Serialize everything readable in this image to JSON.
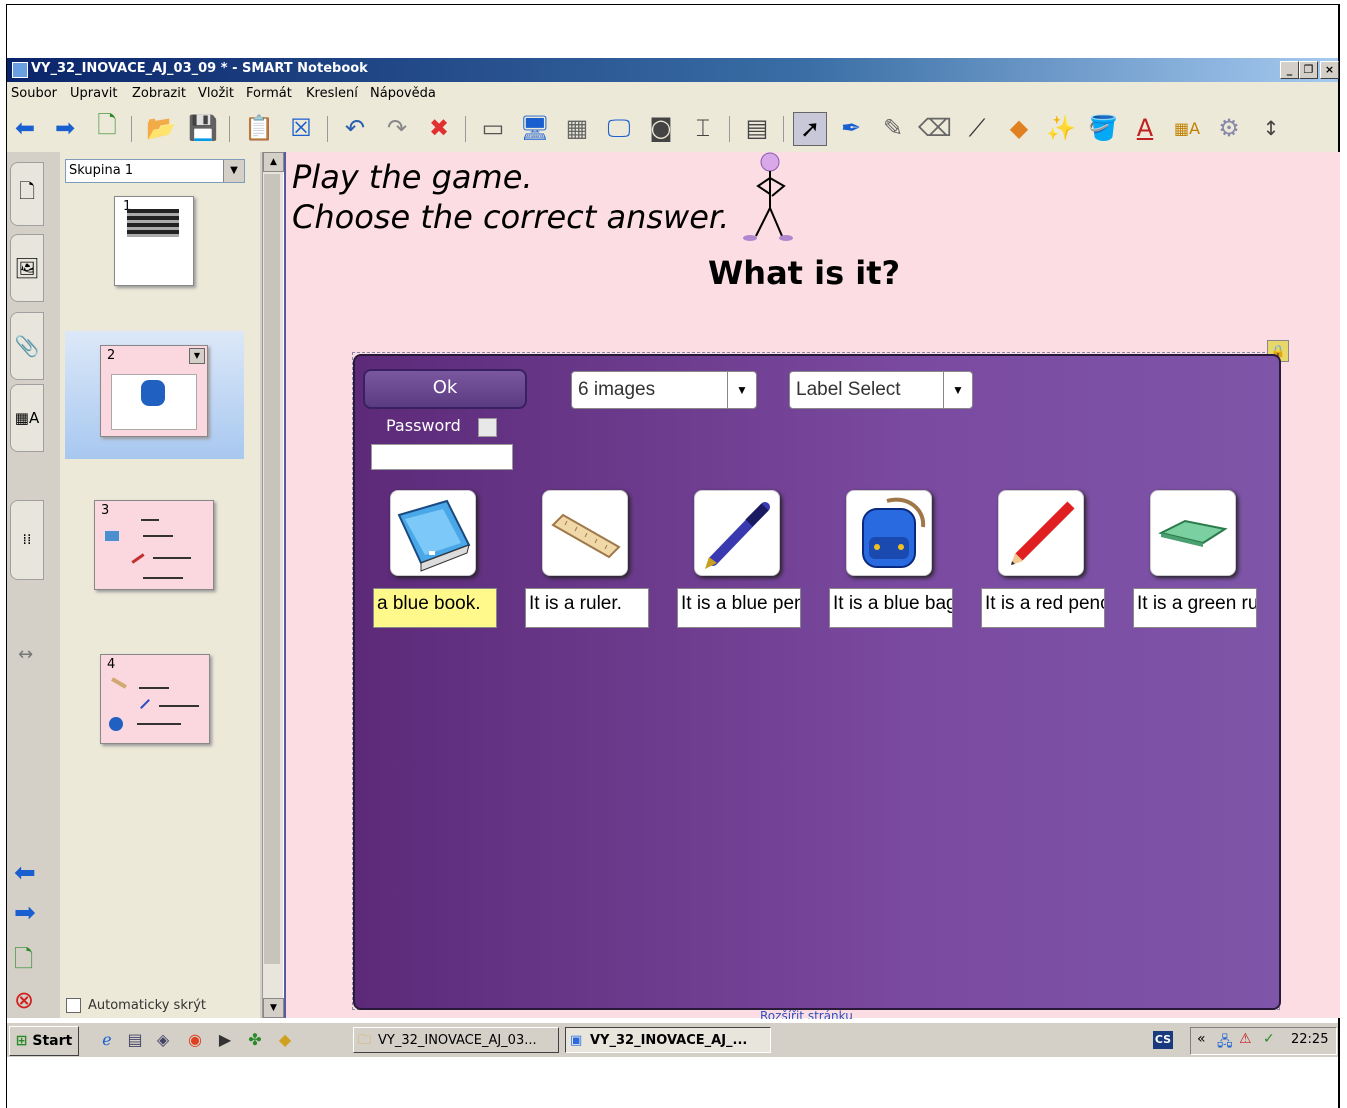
{
  "window": {
    "title": "VY_32_INOVACE_AJ_03_09 * - SMART Notebook",
    "buttons": {
      "minimize": "_",
      "restore": "❐",
      "close": "×"
    }
  },
  "menu": [
    "Soubor",
    "Upravit",
    "Zobrazit",
    "Vložit",
    "Formát",
    "Kreslení",
    "Nápověda"
  ],
  "toolbar": {
    "icons": [
      "back-arrow-icon",
      "forward-arrow-icon",
      "add-page-icon",
      "open-folder-icon",
      "save-icon",
      "paste-icon",
      "delete-page-icon",
      "undo-icon",
      "redo-icon",
      "delete-icon",
      "screen-shade-icon",
      "full-screen-icon",
      "transparent-icon",
      "dual-display-icon",
      "screen-capture-icon",
      "document-camera-icon",
      "table-icon",
      "select-arrow-icon",
      "pen-icon",
      "creative-pen-icon",
      "eraser-icon",
      "line-icon",
      "shape-icon",
      "magic-pen-icon",
      "fill-icon",
      "text-icon",
      "properties-icon",
      "measurement-icon",
      "toolbar-move-icon"
    ]
  },
  "sorter": {
    "group": "Skupina 1",
    "pages": [
      "1",
      "2",
      "3",
      "4"
    ],
    "autohide_label": "Automaticky skrýt"
  },
  "page": {
    "instruction_line1": "Play the game.",
    "instruction_line2": "Choose the correct answer.",
    "question": "What is it?",
    "expand_link": "Rozšířit stránku"
  },
  "game": {
    "ok_button": "Ok",
    "images_select": "6 images",
    "label_select": "Label Select",
    "password_label": "Password",
    "items": [
      {
        "image": "book-image",
        "label": "a blue book.",
        "selected": true
      },
      {
        "image": "ruler-image",
        "label": "It is a ruler.",
        "selected": false
      },
      {
        "image": "pen-image",
        "label": "It is a blue pen",
        "selected": false
      },
      {
        "image": "bag-image",
        "label": "It is a blue bag",
        "selected": false
      },
      {
        "image": "pencil-image",
        "label": "It is a red pencil",
        "selected": false
      },
      {
        "image": "rubber-image",
        "label": "It is a green rubber",
        "selected": false
      }
    ]
  },
  "taskbar": {
    "start": "Start",
    "tasks": [
      "VY_32_INOVACE_AJ_03...",
      "VY_32_INOVACE_AJ_..."
    ],
    "language": "CS",
    "tray_chevron": "«",
    "clock": "22:25"
  },
  "colors": {
    "canvas_bg": "#fcdde3",
    "game_purple": "#6a3a90",
    "label_selected": "#fff98c",
    "title_bar": "#0a246a"
  }
}
